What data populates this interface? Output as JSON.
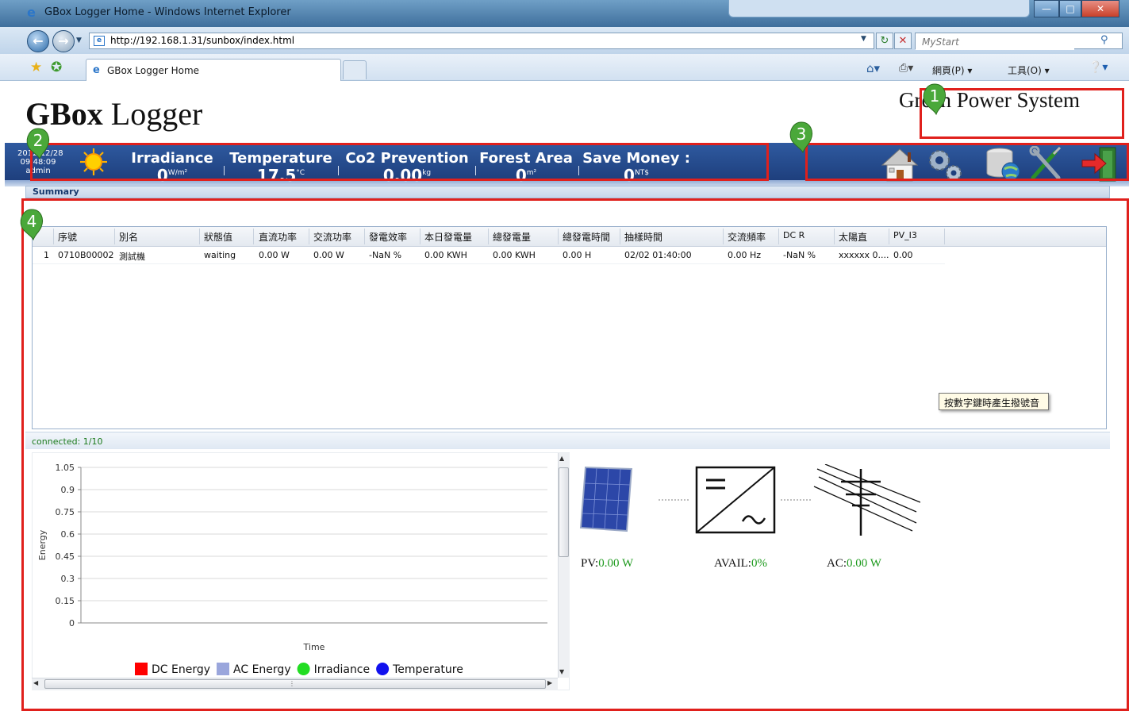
{
  "window": {
    "title": "GBox Logger Home - Windows Internet Explorer",
    "address_url": "http://192.168.1.31/sunbox/index.html",
    "search_placeholder": "MyStart",
    "tab_label": "GBox Logger Home",
    "cmd_page": "網頁(P) ▾",
    "cmd_tools": "工具(O) ▾"
  },
  "page": {
    "logo_bold": "GBox",
    "logo_rest": " Logger",
    "company": "Green Power System",
    "date": "2012/12/28",
    "time": "09:48:09",
    "user": "admin",
    "metrics": [
      {
        "label": "Irradiance",
        "value": "0",
        "unit": "W/m²"
      },
      {
        "label": "Temperature",
        "value": "17.5",
        "unit": "°C"
      },
      {
        "label": "Co2 Prevention",
        "value": "0.00",
        "unit": "kg"
      },
      {
        "label": "Forest Area",
        "value": "0",
        "unit": "m²"
      },
      {
        "label": "Save Money :",
        "value": "0",
        "unit": "NT$"
      }
    ],
    "tools": [
      "home-icon",
      "settings-icon",
      "database-icon",
      "tools-icon",
      "logout-icon"
    ],
    "markers": [
      "1",
      "2",
      "3",
      "4"
    ]
  },
  "summary": {
    "title": "Summary",
    "columns": [
      "序號",
      "別名",
      "狀態值",
      "直流功率",
      "交流功率",
      "發電效率",
      "本日發電量",
      "總發電量",
      "總發電時間",
      "抽樣時間",
      "交流頻率",
      "DC R",
      "太陽直",
      "PV_I3"
    ],
    "rows": [
      {
        "index": "1",
        "cells": [
          "0710B00002",
          "測試機",
          "waiting",
          "0.00 W",
          "0.00 W",
          "-NaN %",
          "0.00 KWH",
          "0.00 KWH",
          "0.00 H",
          "02/02 01:40:00",
          "0.00 Hz",
          "-NaN %",
          "xxxxxx 0....",
          "0.00"
        ]
      }
    ],
    "status": "connected: 1/10",
    "tooltip": "按數字鍵時產生撥號音"
  },
  "chart_data": {
    "type": "line",
    "xlabel": "Time",
    "ylabel": "Energy",
    "ylim": [
      0,
      1.05
    ],
    "yticks": [
      "1.05",
      "0.9",
      "0.75",
      "0.6",
      "0.45",
      "0.3",
      "0.15",
      "0"
    ],
    "series": [
      {
        "name": "DC Energy",
        "color": "#ff0000",
        "values": []
      },
      {
        "name": "AC Energy",
        "color": "#9aa6dc",
        "values": []
      },
      {
        "name": "Irradiance",
        "color": "#22dd22",
        "values": []
      },
      {
        "name": "Temperature",
        "color": "#1111ee",
        "values": []
      }
    ],
    "grid": true,
    "legend": "bottom"
  },
  "flow": {
    "pv": {
      "label": "PV:",
      "value": "0.00 W"
    },
    "avail": {
      "label": "AVAIL:",
      "value": "0%"
    },
    "ac": {
      "label": "AC:",
      "value": "0.00 W"
    }
  }
}
